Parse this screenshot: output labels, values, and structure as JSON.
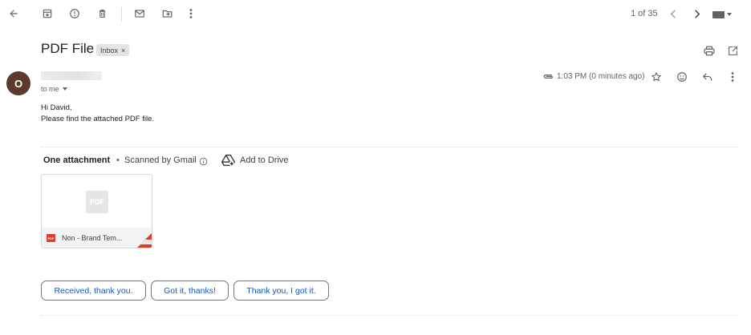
{
  "toolbar": {
    "icons": [
      "back-arrow-icon",
      "archive-icon",
      "report-spam-icon",
      "delete-icon",
      "mark-unread-icon",
      "move-to-icon",
      "more-vert-icon"
    ],
    "pagination": "1 of 35",
    "nav_icons": [
      "chevron-left-icon",
      "chevron-right-icon",
      "input-tools-icon"
    ]
  },
  "email": {
    "subject": "PDF File",
    "label": "Inbox",
    "label_remove": "×",
    "sender_initial": "O",
    "to_line": "to me",
    "timestamp": "1:03 PM (0 minutes ago)",
    "body_lines": [
      "Hi David,",
      "Please find the attached PDF file."
    ]
  },
  "header_actions": {
    "icons": [
      "print-icon",
      "open-in-new-window-icon",
      "attachment-clip-icon",
      "star-icon",
      "emoji-icon",
      "reply-icon",
      "more-vert-icon"
    ]
  },
  "attachments": {
    "title": "One attachment",
    "separator": "•",
    "scanned": "Scanned by Gmail",
    "add_to_drive": "Add to Drive",
    "file": {
      "name": "Non - Brand Tem...",
      "type_badge": "PDF",
      "preview_label": "PDF"
    }
  },
  "smart_replies": [
    "Received, thank you.",
    "Got it, thanks!",
    "Thank you, I got it."
  ],
  "colors": {
    "avatar": "#5b3a2c",
    "link_blue": "#0b57d0",
    "pdf_red": "#db3d2f"
  }
}
